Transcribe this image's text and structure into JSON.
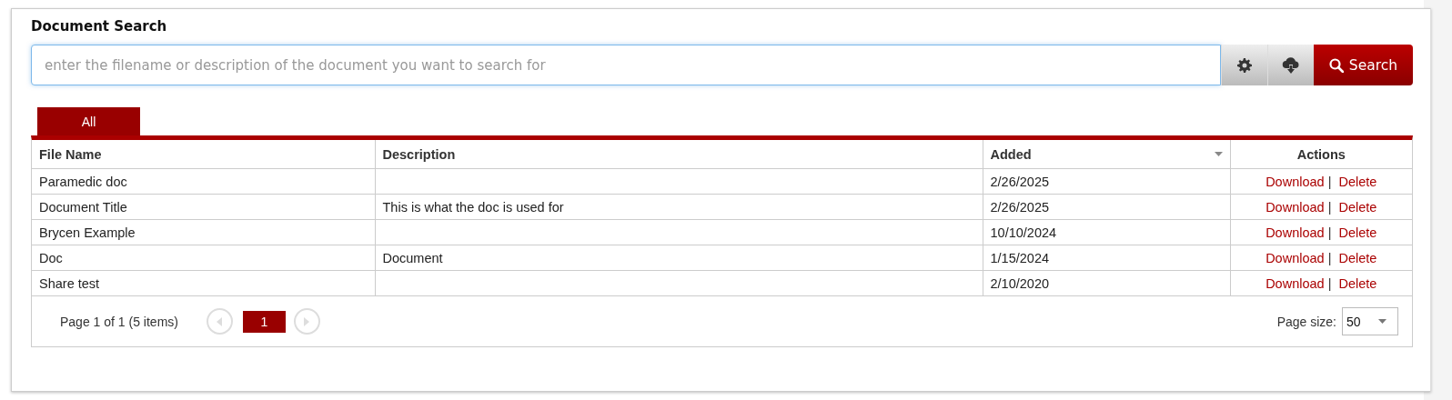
{
  "title": "Document Search",
  "search": {
    "placeholder": "enter the filename or description of the document you want to search for",
    "button": "Search"
  },
  "tabs": [
    {
      "label": "All",
      "selected": true
    }
  ],
  "table": {
    "columns": [
      {
        "label": "File Name",
        "sorted": false
      },
      {
        "label": "Description",
        "sorted": false
      },
      {
        "label": "Added",
        "sorted": true
      },
      {
        "label": "Actions",
        "sorted": false
      }
    ],
    "rows": [
      {
        "file_name": "Paramedic doc",
        "description": "",
        "added": "2/26/2025",
        "actions": [
          "Download",
          "Delete"
        ],
        "separator": "|"
      },
      {
        "file_name": "Document Title",
        "description": "This is what the doc is used for",
        "added": "2/26/2025",
        "actions": [
          "Download",
          "Delete"
        ],
        "separator": "|"
      },
      {
        "file_name": "Brycen Example",
        "description": "",
        "added": "10/10/2024",
        "actions": [
          "Download",
          "Delete"
        ],
        "separator": "|"
      },
      {
        "file_name": "Doc",
        "description": "Document",
        "added": "1/15/2024",
        "actions": [
          "Download",
          "Delete"
        ],
        "separator": "|"
      },
      {
        "file_name": "Share test",
        "description": "",
        "added": "2/10/2020",
        "actions": [
          "Download",
          "Delete"
        ],
        "separator": "|"
      }
    ]
  },
  "pager": {
    "info": "Page 1 of 1 (5 items)",
    "pages": [
      {
        "label": "1",
        "selected": true
      }
    ],
    "size_label": "Page size:",
    "size": "50"
  }
}
